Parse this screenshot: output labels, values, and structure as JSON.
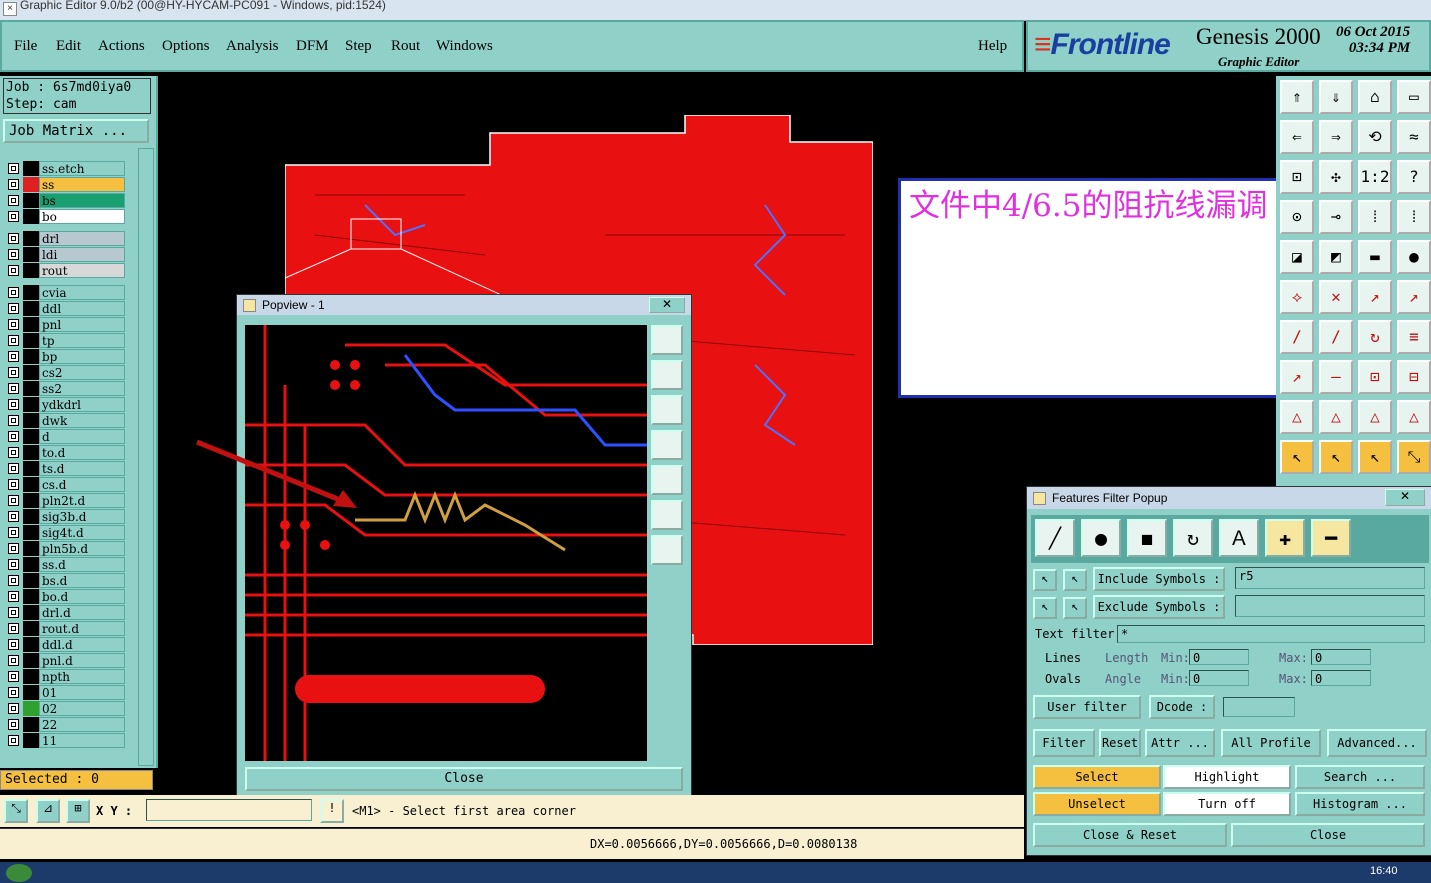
{
  "window": {
    "title": "Graphic Editor 9.0/b2 (00@HY-HYCAM-PC091 - Windows, pid:1524)"
  },
  "menu": [
    "File",
    "Edit",
    "Actions",
    "Options",
    "Analysis",
    "DFM",
    "Step",
    "Rout",
    "Windows"
  ],
  "help": "Help",
  "brand": {
    "logo": "Frontline",
    "product": "Genesis 2000",
    "subtitle": "Graphic Editor",
    "date": "06 Oct 2015",
    "time": "03:34 PM"
  },
  "job": {
    "job_line": "Job : 6s7md0iya0",
    "step_line": "Step: cam",
    "matrix_button": "Job Matrix ..."
  },
  "layers": [
    {
      "name": "ss.etch",
      "color": "#000000"
    },
    {
      "name": "ss",
      "color": "#e02020",
      "highlight": "#f5c040"
    },
    {
      "name": "bs",
      "color": "#000000",
      "highlight": "#1aa070"
    },
    {
      "name": "bo",
      "color": "#000000",
      "highlight": "#ffffff"
    },
    {
      "name": "drl",
      "color": "#000000",
      "highlight": "#b8c8d0"
    },
    {
      "name": "ldi",
      "color": "#000000",
      "highlight": "#b8c8d0"
    },
    {
      "name": "rout",
      "color": "#000000",
      "highlight": "#d8d8d8"
    },
    {
      "name": "cvia",
      "color": "#000000"
    },
    {
      "name": "ddl",
      "color": "#000000"
    },
    {
      "name": "pnl",
      "color": "#000000"
    },
    {
      "name": "tp",
      "color": "#000000"
    },
    {
      "name": "bp",
      "color": "#000000"
    },
    {
      "name": "cs2",
      "color": "#000000"
    },
    {
      "name": "ss2",
      "color": "#000000"
    },
    {
      "name": "ydkdrl",
      "color": "#000000"
    },
    {
      "name": "dwk",
      "color": "#000000"
    },
    {
      "name": "d",
      "color": "#000000"
    },
    {
      "name": "to.d",
      "color": "#000000"
    },
    {
      "name": "ts.d",
      "color": "#000000"
    },
    {
      "name": "cs.d",
      "color": "#000000"
    },
    {
      "name": "pln2t.d",
      "color": "#000000"
    },
    {
      "name": "sig3b.d",
      "color": "#000000"
    },
    {
      "name": "sig4t.d",
      "color": "#000000"
    },
    {
      "name": "pln5b.d",
      "color": "#000000"
    },
    {
      "name": "ss.d",
      "color": "#000000"
    },
    {
      "name": "bs.d",
      "color": "#000000"
    },
    {
      "name": "bo.d",
      "color": "#000000"
    },
    {
      "name": "drl.d",
      "color": "#000000"
    },
    {
      "name": "rout.d",
      "color": "#000000"
    },
    {
      "name": "ddl.d",
      "color": "#000000"
    },
    {
      "name": "pnl.d",
      "color": "#000000"
    },
    {
      "name": "npth",
      "color": "#000000"
    },
    {
      "name": "01",
      "color": "#000000"
    },
    {
      "name": "02",
      "color": "#30a030"
    },
    {
      "name": "22",
      "color": "#000000"
    },
    {
      "name": "11",
      "color": "#000000"
    }
  ],
  "selected": "Selected : 0",
  "status": {
    "xy_label": "X Y :",
    "prompt": "<M1> - Select first area corner"
  },
  "measure": "DX=0.0056666,DY=0.0056666,D=0.0080138",
  "note": "文件中4/6.5的阻抗线漏调",
  "popview": {
    "title": "Popview - 1",
    "close": "Close"
  },
  "filter": {
    "title": "Features Filter Popup",
    "include_label": "Include Symbols :",
    "include_value": "r5",
    "exclude_label": "Exclude Symbols :",
    "exclude_value": "",
    "text_filter_label": "Text filter",
    "text_filter_value": "*",
    "lines": "Lines",
    "ovals": "Ovals",
    "length": "Length",
    "angle": "Angle",
    "min": "Min:",
    "max": "Max:",
    "length_min": "0",
    "length_max": "0",
    "angle_min": "0",
    "angle_max": "0",
    "user_filter": "User filter ...",
    "dcode": "Dcode :",
    "filter": "Filter",
    "reset": "Reset",
    "attr": "Attr ...",
    "all_profile": "All Profile",
    "advanced": "Advanced...",
    "select": "Select",
    "highlight": "Highlight",
    "search": "Search ...",
    "unselect": "Unselect",
    "turn_off": "Turn off",
    "histogram": "Histogram ...",
    "close_reset": "Close & Reset",
    "close": "Close"
  },
  "taskbar": {
    "time": "16:40"
  }
}
